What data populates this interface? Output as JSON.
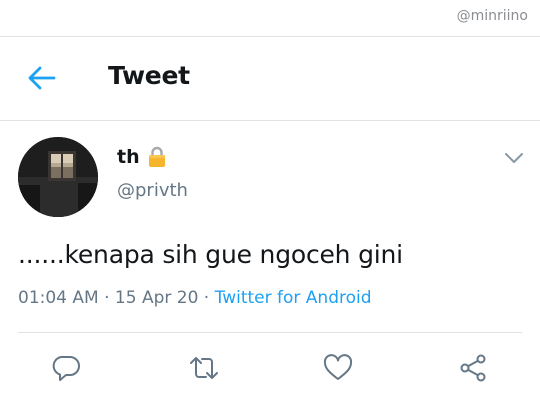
{
  "watermark": "@minriino",
  "header": {
    "title": "Tweet",
    "back_icon": "arrow-left-icon"
  },
  "author": {
    "name": "th",
    "handle": "@privth",
    "protected_icon": "lock-icon",
    "menu_icon": "chevron-down-icon"
  },
  "tweet": {
    "text": "......kenapa sih gue ngoceh gini",
    "time": "01:04 AM",
    "sep1": " · ",
    "date": "15 Apr 20",
    "sep2": " · ",
    "source": "Twitter for Android"
  },
  "actions": [
    "reply-icon",
    "retweet-icon",
    "like-icon",
    "share-icon"
  ],
  "colors": {
    "accent": "#1da1f2",
    "secondary_text": "#657786",
    "divider": "#dfe3e6",
    "icon": "#657786"
  }
}
